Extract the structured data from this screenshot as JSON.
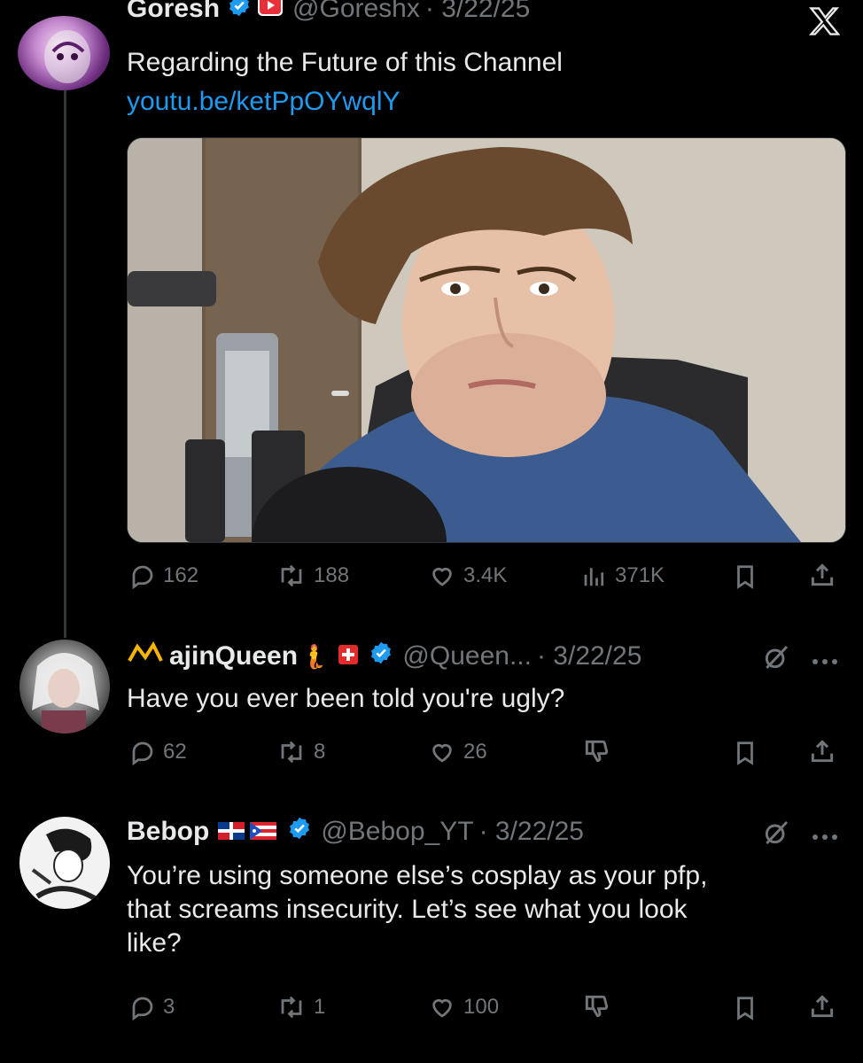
{
  "post": {
    "author_name": "Goresh",
    "handle": "@Goreshx",
    "date": "· 3/22/25",
    "text": "Regarding the Future of this Channel",
    "link": "youtu.be/ketPpOYwqlY",
    "stats": {
      "replies": "162",
      "reposts": "188",
      "likes": "3.4K",
      "views": "371K"
    }
  },
  "replies": [
    {
      "author_name": "ajinQueen",
      "handle": "@Queen...",
      "date": "· 3/22/25",
      "text": "Have you ever been told you're ugly?",
      "stats": {
        "replies": "62",
        "reposts": "8",
        "likes": "26"
      }
    },
    {
      "author_name": "Bebop",
      "handle": "@Bebop_YT",
      "date": "· 3/22/25",
      "text_lines": [
        "You’re using someone else’s cosplay as your pfp,",
        "that screams insecurity. Let’s see what you look",
        "like?"
      ],
      "stats": {
        "replies": "3",
        "reposts": "1",
        "likes": "100"
      }
    }
  ],
  "colors": {
    "background": "#000000",
    "text": "#e7e9ea",
    "muted": "#71767b",
    "link": "#1d9bf0",
    "verified": "#1d9bf0"
  },
  "icons": [
    "x-logo-icon",
    "verified-icon",
    "youtube-icon",
    "reply-icon",
    "repost-icon",
    "like-icon",
    "views-icon",
    "bookmark-icon",
    "share-icon",
    "grok-icon",
    "more-icon",
    "downvote-icon",
    "flag-icon"
  ]
}
